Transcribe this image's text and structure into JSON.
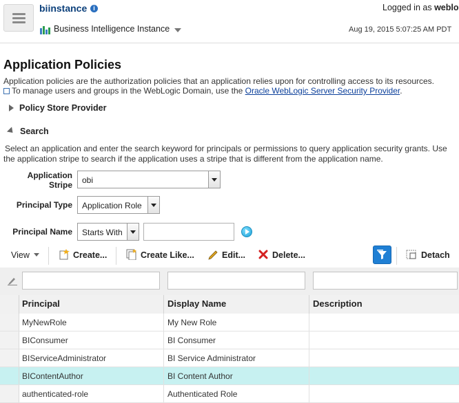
{
  "header": {
    "instance_title": "biinstance",
    "logged_in_label": "Logged in as",
    "logged_in_user": "weblo",
    "instance_menu": "Business Intelligence Instance",
    "timestamp": "Aug 19, 2015 5:07:25 AM PDT"
  },
  "page": {
    "title": "Application Policies",
    "description": "Application policies are the authorization policies that an application relies upon for controlling access to its resources.",
    "manage_text": "To manage users and groups in the WebLogic Domain, use the",
    "manage_link": "Oracle WebLogic Server Security Provider",
    "manage_end": "."
  },
  "policy_store": {
    "label": "Policy Store Provider"
  },
  "search": {
    "label": "Search",
    "instructions_line1": "Select an application and enter the search keyword for principals or permissions to query application security grants. Use",
    "instructions_line2": "the application stripe to search if the application uses a stripe that is different from the application name.",
    "stripe_label_1": "Application",
    "stripe_label_2": "Stripe",
    "stripe_value": "obi",
    "principal_type_label": "Principal Type",
    "principal_type_value": "Application Role",
    "principal_name_label": "Principal Name",
    "principal_name_op": "Starts With",
    "principal_name_value": ""
  },
  "toolbar": {
    "view": "View",
    "create": "Create...",
    "create_like": "Create Like...",
    "edit": "Edit...",
    "delete": "Delete...",
    "detach": "Detach"
  },
  "table": {
    "columns": [
      "Principal",
      "Display Name",
      "Description"
    ],
    "rows": [
      {
        "principal": "MyNewRole",
        "display": "My New Role",
        "description": ""
      },
      {
        "principal": "BIConsumer",
        "display": "BI Consumer",
        "description": ""
      },
      {
        "principal": "BIServiceAdministrator",
        "display": "BI Service Administrator",
        "description": ""
      },
      {
        "principal": "BIContentAuthor",
        "display": "BI Content Author",
        "description": ""
      },
      {
        "principal": "authenticated-role",
        "display": "Authenticated Role",
        "description": ""
      }
    ],
    "selected_row": 3
  },
  "colors": {
    "accent": "#1f7fd4",
    "selected_row": "#c7f1f1",
    "link": "#0b3f9a"
  },
  "icons": [
    "hamburger-icon",
    "info-icon",
    "bi-instance-icon",
    "chevron-down-icon",
    "external-link-icon",
    "expand-triangle-icon",
    "collapse-triangle-icon",
    "go-arrow-icon",
    "create-icon",
    "create-like-icon",
    "edit-pencil-icon",
    "delete-x-icon",
    "query-by-example-icon",
    "detach-icon",
    "clear-filter-icon"
  ]
}
